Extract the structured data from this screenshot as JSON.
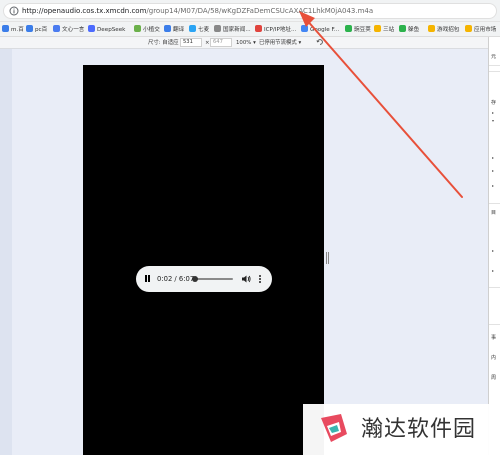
{
  "browser": {
    "url_host": "http://openaudio.cos.tx.xmcdn.com",
    "url_path": "/group14/M07/DA/58/wKgDZFaDemCSUcAXAC1LhkM0jA043.m4a"
  },
  "bookmarks": [
    {
      "label": "m.百",
      "color": "#3b7de9"
    },
    {
      "label": "pc百",
      "color": "#3b7de9"
    },
    {
      "label": "文心一言",
      "color": "#4a7bf0"
    },
    {
      "label": "DeepSeek",
      "color": "#4d6bfe"
    },
    {
      "label": "小植交",
      "color": "#6bb04a"
    },
    {
      "label": "翻译",
      "color": "#3b7de9"
    },
    {
      "label": "七麦",
      "color": "#2aa4f4"
    },
    {
      "label": "国家新闻...",
      "color": "#888888"
    },
    {
      "label": "ICP/IP地址...",
      "color": "#e0443e"
    },
    {
      "label": "Google F...",
      "color": "#4285f4"
    },
    {
      "label": "豌豆荚",
      "color": "#2bb24c"
    },
    {
      "label": "三站",
      "color": "#f5b400"
    },
    {
      "label": "躲鱼",
      "color": "#2bb24c"
    },
    {
      "label": "游戏招包",
      "color": "#f5b400"
    },
    {
      "label": "应用市场",
      "color": "#f5b400"
    }
  ],
  "device_toolbar": {
    "dimensions_label": "尺寸: 自适应 ▾",
    "width_value": "531",
    "separator": "×",
    "height_value": "647",
    "zoom": "100% ▾",
    "throttling": "已停用节流模式 ▾"
  },
  "player": {
    "time": "0:02 / 6:07",
    "progress_fraction": 0.005
  },
  "devtools": {
    "items": [
      "元",
      "存",
      "▸",
      "▾",
      "▸",
      "▸",
      "▸",
      "目",
      "▸",
      "▸",
      "事",
      "内",
      "周"
    ]
  },
  "watermark": {
    "text": "瀚达软件园"
  },
  "colors": {
    "annotation_arrow": "#e8503a",
    "video_bg": "#000000",
    "viewport_bg": "#e9edf7"
  }
}
